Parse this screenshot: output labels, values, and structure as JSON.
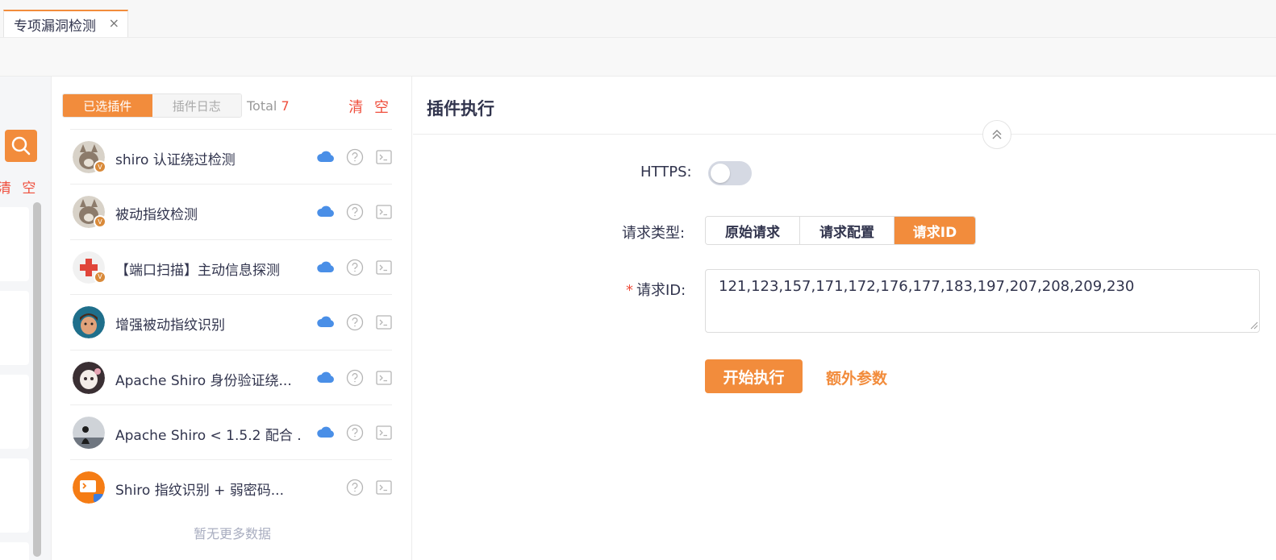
{
  "tabs": [
    {
      "label": "专项漏洞检测",
      "close": "×"
    }
  ],
  "left_panel": {
    "clear_label": "清 空"
  },
  "plugin_panel": {
    "tab_selected": "已选插件",
    "tab_log": "插件日志",
    "total_label": "Total",
    "total_count": "7",
    "clear_label": "清 空",
    "plugins": [
      {
        "name": "shiro 认证绕过检测",
        "avatar": "cat-avatar",
        "cloud": true
      },
      {
        "name": "被动指纹检测",
        "avatar": "cat-avatar",
        "cloud": true
      },
      {
        "name": "【端口扫描】主动信息探测",
        "avatar": "red-cross-avatar",
        "cloud": true
      },
      {
        "name": "增强被动指纹识别",
        "avatar": "cartoon-man-avatar",
        "cloud": true
      },
      {
        "name": "Apache Shiro 身份验证绕...",
        "avatar": "anime-girl-avatar",
        "cloud": true
      },
      {
        "name": "Apache Shiro < 1.5.2 配合 ...",
        "avatar": "silhouette-avatar",
        "cloud": true
      },
      {
        "name": "Shiro 指纹识别 + 弱密码...",
        "avatar": "orange-terminal-avatar",
        "cloud": false
      }
    ],
    "no_more": "暂无更多数据"
  },
  "main_panel": {
    "title": "插件执行",
    "https_label": "HTTPS:",
    "https_enabled": false,
    "request_type_label": "请求类型:",
    "request_types": [
      "原始请求",
      "请求配置",
      "请求ID"
    ],
    "request_type_selected": "请求ID",
    "request_id_label": "请求ID:",
    "request_id_required": "*",
    "request_id_value": "121,123,157,171,172,176,177,183,197,207,208,209,230",
    "run_button": "开始执行",
    "extra_params": "额外参数"
  },
  "colors": {
    "accent": "#f28c3c",
    "danger": "#ef4e3c",
    "cloud": "#4a8fe7"
  }
}
